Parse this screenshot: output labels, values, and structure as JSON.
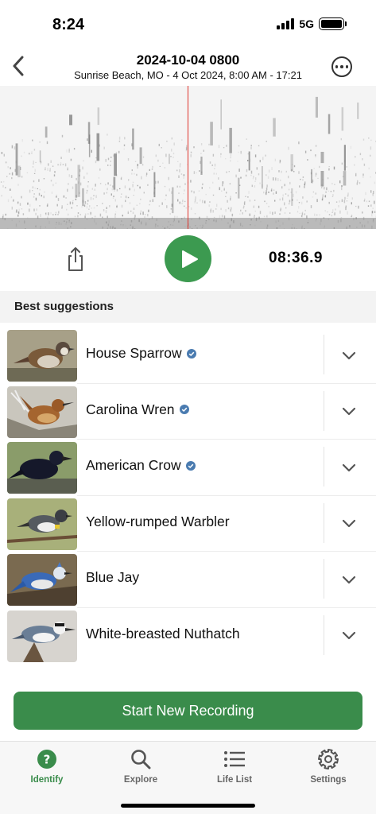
{
  "status": {
    "time": "8:24",
    "network": "5G"
  },
  "header": {
    "title": "2024-10-04 0800",
    "subtitle": "Sunrise Beach, MO - 4 Oct 2024, 8:00 AM - 17:21",
    "back_icon": "chevron-left-icon",
    "more_icon": "ellipsis-circle-icon"
  },
  "player": {
    "elapsed": "08:36.9",
    "share_icon": "share-icon",
    "play_icon": "play-icon"
  },
  "section_title": "Best suggestions",
  "suggestions": [
    {
      "name": "House Sparrow",
      "verified": true
    },
    {
      "name": "Carolina Wren",
      "verified": true
    },
    {
      "name": "American Crow",
      "verified": true
    },
    {
      "name": "Yellow-rumped Warbler",
      "verified": false
    },
    {
      "name": "Blue Jay",
      "verified": false
    },
    {
      "name": "White-breasted Nuthatch",
      "verified": false
    }
  ],
  "start_button": "Start New Recording",
  "tabs": [
    {
      "label": "Identify",
      "icon": "question-circle-icon",
      "active": true
    },
    {
      "label": "Explore",
      "icon": "search-icon",
      "active": false
    },
    {
      "label": "Life List",
      "icon": "list-icon",
      "active": false
    },
    {
      "label": "Settings",
      "icon": "gear-icon",
      "active": false
    }
  ],
  "colors": {
    "accent": "#3a8c4b",
    "playhead": "#e0332b",
    "verified": "#4a7bb0"
  }
}
